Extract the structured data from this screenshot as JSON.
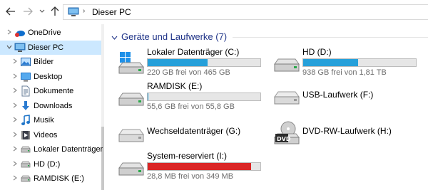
{
  "address": {
    "path": "Dieser PC"
  },
  "sidebar": {
    "items": [
      {
        "label": "OneDrive",
        "icon": "onedrive-icon",
        "selected": false
      },
      {
        "label": "Dieser PC",
        "icon": "this-pc-icon",
        "selected": true
      },
      {
        "label": "Bilder",
        "icon": "pictures-icon",
        "selected": false
      },
      {
        "label": "Desktop",
        "icon": "desktop-icon",
        "selected": false
      },
      {
        "label": "Dokumente",
        "icon": "documents-icon",
        "selected": false
      },
      {
        "label": "Downloads",
        "icon": "downloads-icon",
        "selected": false
      },
      {
        "label": "Musik",
        "icon": "music-icon",
        "selected": false
      },
      {
        "label": "Videos",
        "icon": "videos-icon",
        "selected": false
      },
      {
        "label": "Lokaler Datenträger",
        "icon": "drive-icon",
        "selected": false
      },
      {
        "label": "HD (D:)",
        "icon": "drive-icon",
        "selected": false
      },
      {
        "label": "RAMDISK (E:)",
        "icon": "drive-icon",
        "selected": false
      }
    ]
  },
  "main": {
    "group_title": "Geräte und Laufwerke (7)",
    "drives": [
      {
        "name": "Lokaler Datenträger (C:)",
        "free": "220 GB frei von 465 GB",
        "used_fraction": 0.53,
        "bar_color": "#26a0da",
        "icon": "system-drive-icon"
      },
      {
        "name": "HD (D:)",
        "free": "938 GB frei von 1,81 TB",
        "used_fraction": 0.49,
        "bar_color": "#26a0da",
        "icon": "hard-drive-icon"
      },
      {
        "name": "RAMDISK (E:)",
        "free": "55,6 GB frei von 55,8 GB",
        "used_fraction": 0.004,
        "bar_color": "#26a0da",
        "icon": "hard-drive-icon"
      },
      {
        "name": "USB-Laufwerk (F:)",
        "icon": "usb-drive-icon"
      },
      {
        "name": "Wechseldatenträger (G:)",
        "icon": "removable-drive-icon"
      },
      {
        "name": "DVD-RW-Laufwerk (H:)",
        "icon": "dvd-drive-icon",
        "dvd_label": "DVD"
      },
      {
        "name": "System-reserviert (I:)",
        "free": "28,8 MB frei von 349 MB",
        "used_fraction": 0.92,
        "bar_color": "#da2626",
        "icon": "hard-drive-icon"
      }
    ]
  }
}
